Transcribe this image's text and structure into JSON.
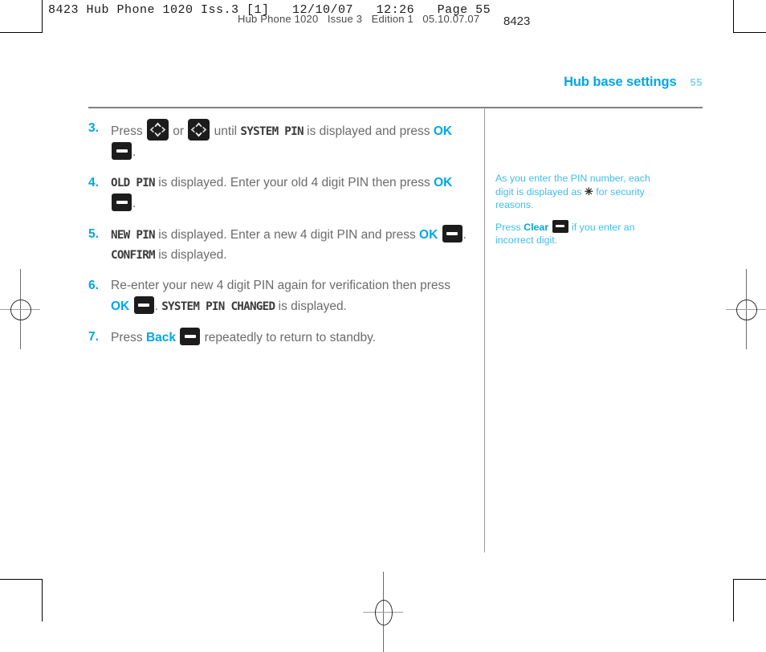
{
  "prepress": {
    "slug_primary": "8423 Hub Phone 1020 Iss.3 [1]   12/10/07   12:26   Page 55",
    "slug_secondary": "Hub Phone 1020   Issue 3   Edition 1   05.10.07.07",
    "slug_code": "8423",
    "registration_mark": "registration-mark",
    "crop_mark": "crop-mark"
  },
  "running_head": {
    "title": "Hub base settings",
    "folio": "55"
  },
  "steps": [
    {
      "number": "3.",
      "parts": [
        {
          "type": "text",
          "value": "Press "
        },
        {
          "type": "nav-key-up",
          "value": "nav-key"
        },
        {
          "type": "text",
          "value": " or "
        },
        {
          "type": "nav-key-down",
          "value": "nav-key"
        },
        {
          "type": "text",
          "value": " until "
        },
        {
          "type": "lcd",
          "value": "SYSTEM PIN"
        },
        {
          "type": "text",
          "value": " is displayed and press "
        },
        {
          "type": "key-label",
          "value": "OK"
        },
        {
          "type": "soft-key",
          "value": "soft-key"
        },
        {
          "type": "text",
          "value": "."
        }
      ]
    },
    {
      "number": "4.",
      "parts": [
        {
          "type": "lcd",
          "value": "OLD PIN"
        },
        {
          "type": "text",
          "value": " is displayed. Enter your old 4 digit PIN then press "
        },
        {
          "type": "key-label",
          "value": "OK"
        },
        {
          "type": "soft-key",
          "value": "soft-key"
        },
        {
          "type": "text",
          "value": "."
        }
      ]
    },
    {
      "number": "5.",
      "parts": [
        {
          "type": "lcd",
          "value": "NEW PIN"
        },
        {
          "type": "text",
          "value": " is displayed. Enter a new 4 digit PIN and press "
        },
        {
          "type": "key-label",
          "value": "OK"
        },
        {
          "type": "soft-key",
          "value": "soft-key"
        },
        {
          "type": "text",
          "value": ". "
        },
        {
          "type": "lcd",
          "value": "CONFIRM"
        },
        {
          "type": "text",
          "value": " is displayed."
        }
      ]
    },
    {
      "number": "6.",
      "parts": [
        {
          "type": "text",
          "value": "Re-enter your new 4 digit PIN again for verification then press "
        },
        {
          "type": "key-label",
          "value": "OK"
        },
        {
          "type": "soft-key",
          "value": "soft-key"
        },
        {
          "type": "text",
          "value": ". "
        },
        {
          "type": "lcd",
          "value": "SYSTEM PIN CHANGED"
        },
        {
          "type": "text",
          "value": " is displayed."
        }
      ]
    },
    {
      "number": "7.",
      "parts": [
        {
          "type": "text",
          "value": "Press "
        },
        {
          "type": "key-label",
          "value": "Back"
        },
        {
          "type": "soft-key",
          "value": "soft-key"
        },
        {
          "type": "text",
          "value": " repeatedly to return to standby."
        }
      ]
    }
  ],
  "note": {
    "paragraph_1_before": "As you enter the PIN number, each digit is displayed as ",
    "paragraph_1_symbol": "✳",
    "paragraph_1_after": " for security reasons.",
    "paragraph_2_before": "Press ",
    "paragraph_2_bold": "Clear",
    "paragraph_2_after": " if you enter an incorrect digit."
  },
  "colors": {
    "accent": "#00a7e7",
    "accent_light": "#7fd3f2",
    "note_text": "#3fbdee",
    "body_text": "#6b6b6b",
    "lcd_text": "#3a3a3a",
    "key_dark": "#1c1c1c",
    "rule": "#808080"
  }
}
